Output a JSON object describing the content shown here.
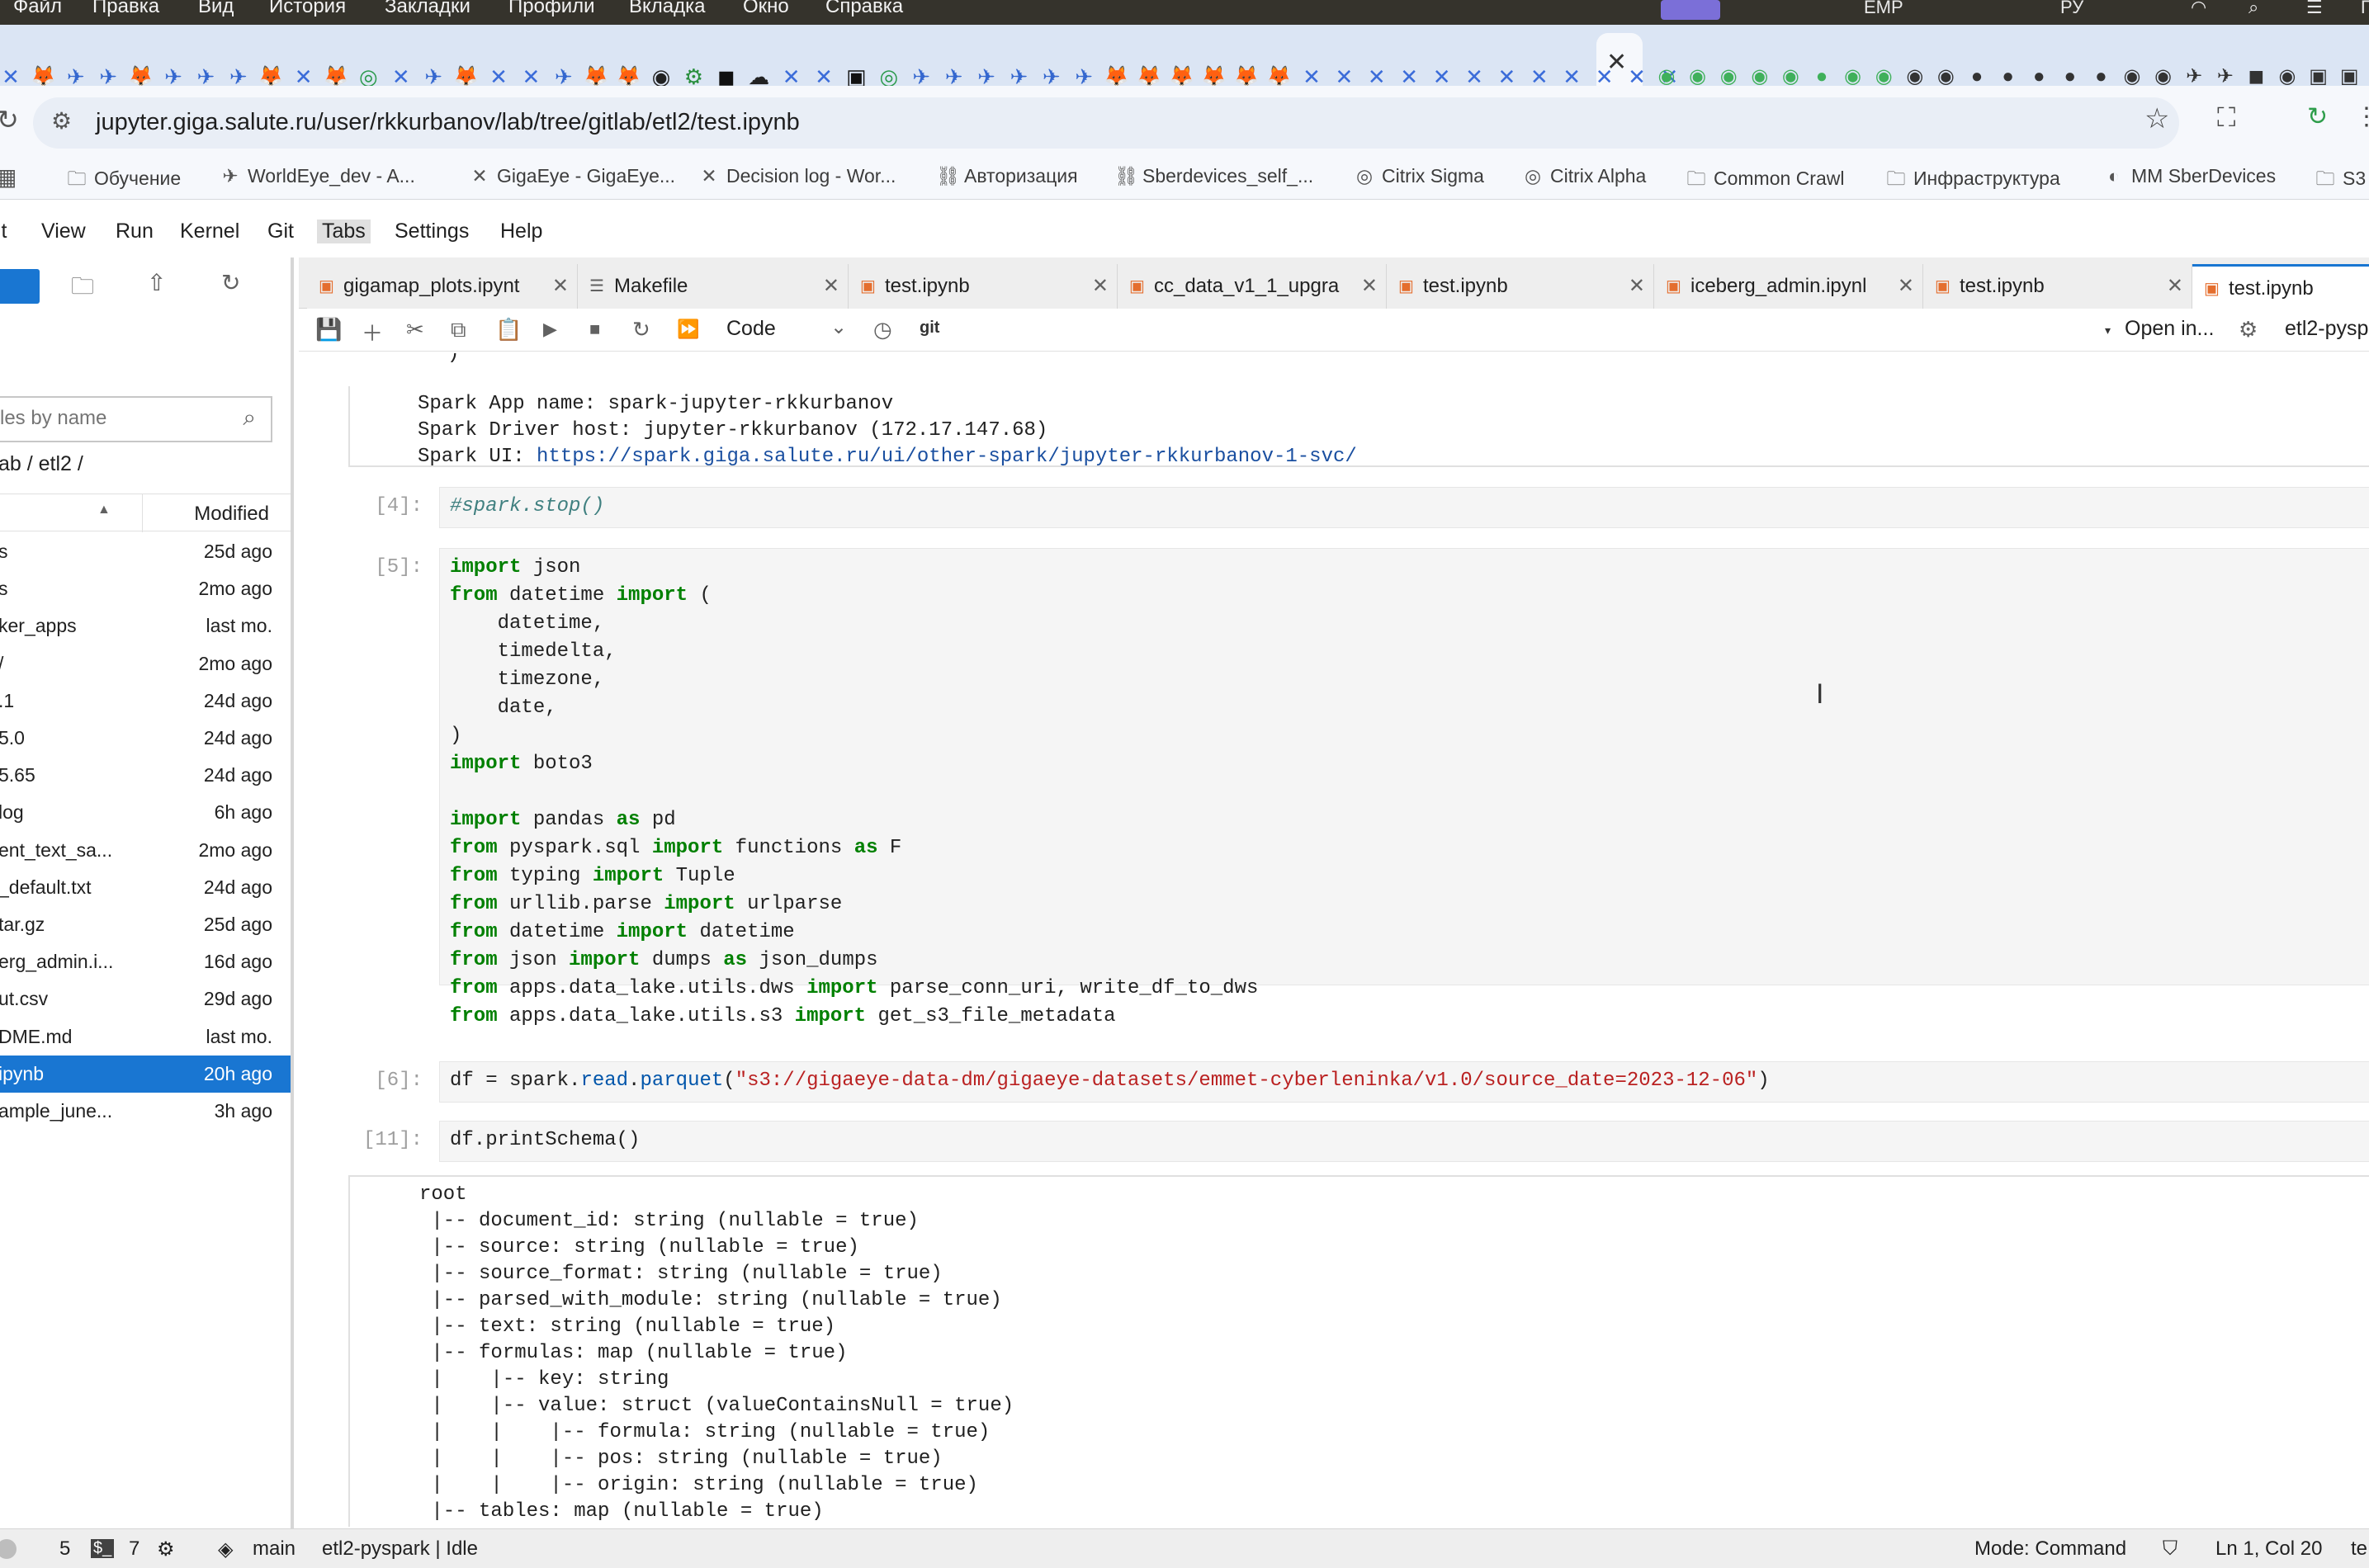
{
  "mac_menu": {
    "items": [
      "Файл",
      "Правка",
      "Вид",
      "История",
      "Закладки",
      "Профили",
      "Вкладка",
      "Окно",
      "Справка"
    ],
    "right": [
      "EMP",
      "РУ",
      "ПТ"
    ]
  },
  "browser": {
    "url": "jupyter.giga.salute.ru/user/rkkurbanov/lab/tree/gitlab/etl2/test.ipynb",
    "bookmarks": [
      {
        "icon": "folder-icon",
        "glyph": "🗀",
        "label": "Обучение"
      },
      {
        "icon": "worldeye-icon",
        "glyph": "✈",
        "label": "WorldEye_dev - A..."
      },
      {
        "icon": "gigaeye-icon",
        "glyph": "✕",
        "label": "GigaEye - GigaEye..."
      },
      {
        "icon": "gigaeye-icon",
        "glyph": "✕",
        "label": "Decision log - Wor..."
      },
      {
        "icon": "auth-icon",
        "glyph": "⛓",
        "label": "Авторизация"
      },
      {
        "icon": "sberdevices-icon",
        "glyph": "⛓",
        "label": "Sberdevices_self_..."
      },
      {
        "icon": "citrix-icon",
        "glyph": "◎",
        "label": "Citrix Sigma"
      },
      {
        "icon": "citrix-icon",
        "glyph": "◎",
        "label": "Citrix Alpha"
      },
      {
        "icon": "folder-icon",
        "glyph": "🗀",
        "label": "Common Crawl"
      },
      {
        "icon": "folder-icon",
        "glyph": "🗀",
        "label": "Инфраструктура"
      },
      {
        "icon": "mm-icon",
        "glyph": "◐",
        "label": "MM SberDevices"
      },
      {
        "icon": "folder-icon",
        "glyph": "🗀",
        "label": "S3"
      }
    ]
  },
  "jupyter_menu": [
    "it",
    "View",
    "Run",
    "Kernel",
    "Git",
    "Tabs",
    "Settings",
    "Help"
  ],
  "sidebar": {
    "filter_placeholder": "les by name",
    "breadcrumb": "ab / etl2 /",
    "modified_header": "Modified",
    "files": [
      {
        "name": "s",
        "modified": "25d ago"
      },
      {
        "name": "s",
        "modified": "2mo ago"
      },
      {
        "name": "ker_apps",
        "modified": "last mo."
      },
      {
        "name": "/",
        "modified": "2mo ago"
      },
      {
        "name": ".1",
        "modified": "24d ago"
      },
      {
        "name": "5.0",
        "modified": "24d ago"
      },
      {
        "name": "5.65",
        "modified": "24d ago"
      },
      {
        "name": "log",
        "modified": "6h ago"
      },
      {
        "name": "ent_text_sa...",
        "modified": "2mo ago"
      },
      {
        "name": "_default.txt",
        "modified": "24d ago"
      },
      {
        "name": "tar.gz",
        "modified": "25d ago"
      },
      {
        "name": "erg_admin.i...",
        "modified": "16d ago"
      },
      {
        "name": "ut.csv",
        "modified": "29d ago"
      },
      {
        "name": "DME.md",
        "modified": "last mo."
      },
      {
        "name": "ipynb",
        "modified": "20h ago",
        "selected": true
      },
      {
        "name": "ample_june...",
        "modified": "3h ago"
      }
    ]
  },
  "notebook_tabs": [
    {
      "label": "gigamap_plots.ipynt",
      "icon": "notebook-icon"
    },
    {
      "label": "Makefile",
      "icon": "file-icon"
    },
    {
      "label": "test.ipynb",
      "icon": "notebook-icon"
    },
    {
      "label": "cc_data_v1_1_upgra",
      "icon": "notebook-icon"
    },
    {
      "label": "test.ipynb",
      "icon": "notebook-icon"
    },
    {
      "label": "iceberg_admin.ipynl",
      "icon": "notebook-icon"
    },
    {
      "label": "test.ipynb",
      "icon": "notebook-icon"
    },
    {
      "label": "test.ipynb",
      "icon": "notebook-icon",
      "active": true
    }
  ],
  "toolbar": {
    "cell_type": "Code",
    "git_label": "git",
    "open_in": "Open in...",
    "kernel": "etl2-pyspa"
  },
  "cells": {
    "prev_tail": ")",
    "spark_out": {
      "line1": "Spark App name: spark-jupyter-rkkurbanov",
      "line2": "Spark Driver host: jupyter-rkkurbanov (172.17.147.68)",
      "line3_label": "Spark UI: ",
      "line3_link": "https://spark.giga.salute.ru/ui/other-spark/jupyter-rkkurbanov-1-svc/"
    },
    "c4": {
      "prompt": "[4]:",
      "code": "#spark.stop()"
    },
    "c5": {
      "prompt": "[5]:"
    },
    "c6": {
      "prompt": "[6]:",
      "path": "\"s3://gigaeye-data-dm/gigaeye-datasets/emmet-cyberleninka/v1.0/source_date=2023-12-06\""
    },
    "c11": {
      "prompt": "[11]:",
      "code": "df.printSchema()"
    },
    "schema": "root\n |-- document_id: string (nullable = true)\n |-- source: string (nullable = true)\n |-- source_format: string (nullable = true)\n |-- parsed_with_module: string (nullable = true)\n |-- text: string (nullable = true)\n |-- formulas: map (nullable = true)\n |    |-- key: string\n |    |-- value: struct (valueContainsNull = true)\n |    |    |-- formula: string (nullable = true)\n |    |    |-- pos: string (nullable = true)\n |    |    |-- origin: string (nullable = true)\n |-- tables: map (nullable = true)"
  },
  "status": {
    "count1": "5",
    "count2": "7",
    "branch": "main",
    "kernel_status": "etl2-pyspark | Idle",
    "mode": "Mode: Command",
    "position": "Ln 1, Col 20",
    "tail": "te"
  }
}
